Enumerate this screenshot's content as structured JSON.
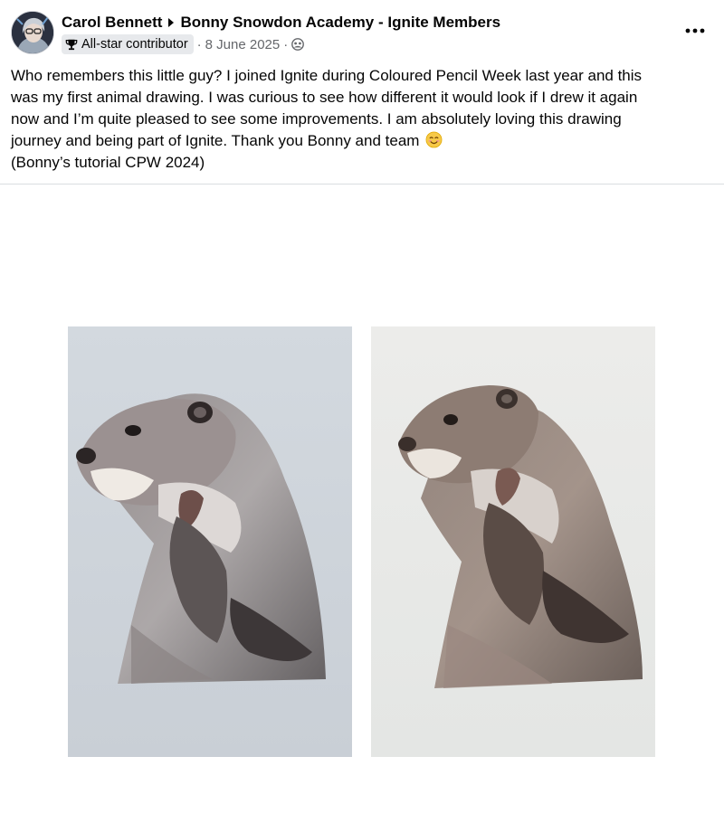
{
  "post": {
    "author": "Carol Bennett",
    "group": "Bonny Snowdon Academy - Ignite Members",
    "badge": "All-star contributor",
    "separator": "·",
    "date": "8 June 2025",
    "body_lines": [
      "Who remembers this little guy? I joined Ignite during Coloured Pencil Week last year and this",
      "was my first animal drawing. I was curious to see how different it would look if I drew it again",
      "now and I’m quite pleased to see some improvements. I am absolutely loving this drawing",
      "journey and being part of Ignite. Thank you Bonny and team",
      "(Bonny’s tutorial CPW 2024)"
    ],
    "icons": {
      "badge": "trophy-icon",
      "audience": "group-audience-icon",
      "more": "more-options-icon",
      "emoji": "smiling-face-emoji",
      "arrow": "caret-right-icon"
    }
  },
  "colors": {
    "text": "#050505",
    "secondary_text": "#65676b",
    "badge_bg": "#e7e9ec",
    "divider": "#dadde1"
  }
}
